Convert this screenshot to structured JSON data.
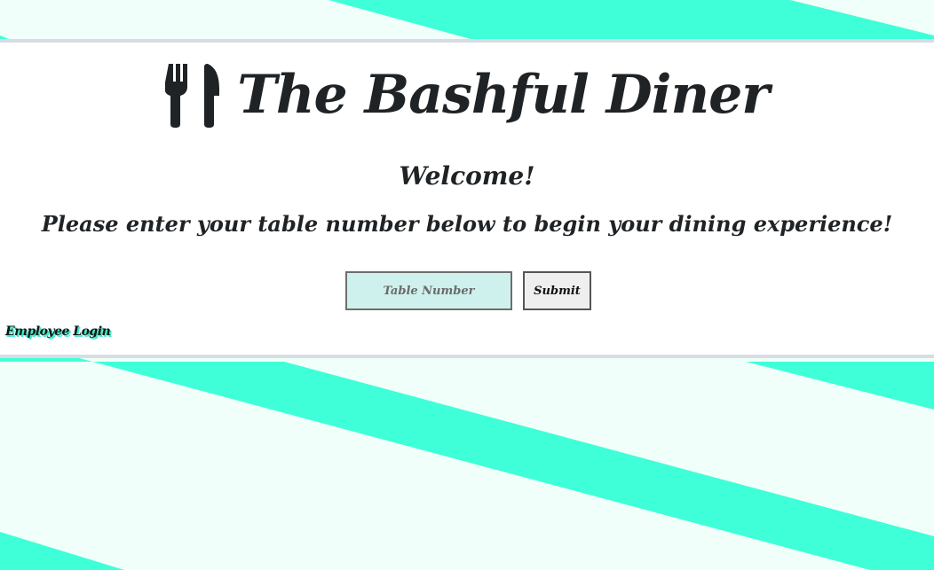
{
  "header": {
    "title": "The Bashful Diner",
    "icon": "utensils-icon"
  },
  "welcome": {
    "heading": "Welcome!",
    "instruction": "Please enter your table number below to begin your dining experience!"
  },
  "form": {
    "table_input_placeholder": "Table Number",
    "table_input_value": "",
    "submit_label": "Submit"
  },
  "footer_link": {
    "label": "Employee Login"
  },
  "colors": {
    "stripe": "#3fffd8",
    "background": "#f0fff9",
    "panel": "#ffffff",
    "text": "#1f2326",
    "input_bg": "#cff1ee"
  }
}
